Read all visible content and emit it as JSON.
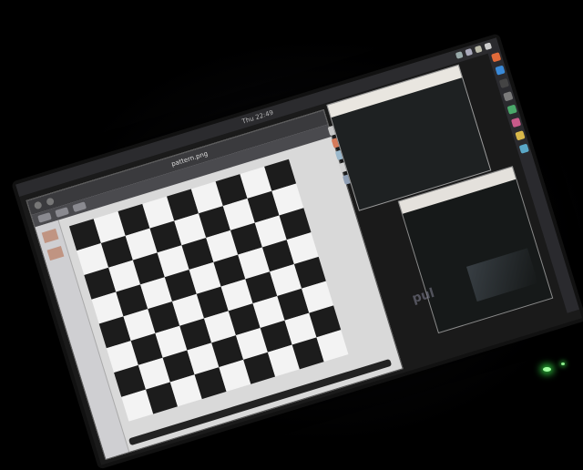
{
  "system_bar": {
    "clock": "Thu 22:49"
  },
  "viewer": {
    "title": "pattern.png"
  },
  "board": {
    "columns": 9,
    "rows": 8
  },
  "desktop": {
    "background_text": "pul"
  },
  "colors": {
    "board_dark": "#1c1c1c",
    "board_light": "#f3f3f3",
    "led": "#3cff50"
  },
  "icons": {
    "dock": [
      "browser-icon",
      "folder-icon",
      "terminal-icon",
      "settings-icon",
      "chat-icon",
      "music-icon",
      "mail-icon",
      "calendar-icon"
    ],
    "tray": [
      "wifi-icon",
      "volume-icon",
      "battery-icon",
      "power-icon"
    ]
  }
}
